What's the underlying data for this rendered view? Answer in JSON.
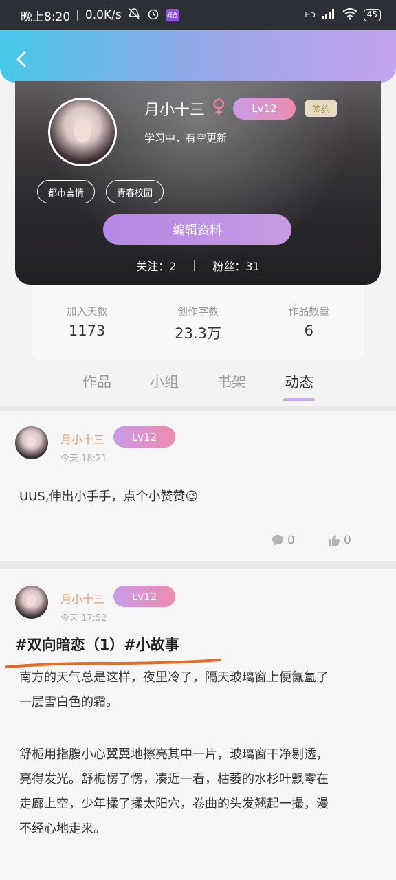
{
  "status_bar": {
    "time": "晚上8:20",
    "speed": "0.0K/s",
    "app_badge": "概览",
    "network": "HD",
    "battery": "45"
  },
  "profile": {
    "name": "月小十三",
    "gender_symbol": "♀",
    "level": "Lv12",
    "signed_label": "签约",
    "bio": "学习中，有空更新",
    "tags": [
      "都市言情",
      "青春校园"
    ],
    "edit_button": "编辑资料",
    "following": "关注：2",
    "followers": "粉丝：31"
  },
  "stats": [
    {
      "label": "加入天数",
      "value": "1173"
    },
    {
      "label": "创作字数",
      "value": "23.3万"
    },
    {
      "label": "作品数量",
      "value": "6"
    }
  ],
  "tabs": [
    {
      "label": "作品",
      "active": false
    },
    {
      "label": "小组",
      "active": false
    },
    {
      "label": "书架",
      "active": false
    },
    {
      "label": "动态",
      "active": true
    }
  ],
  "posts": [
    {
      "author": "月小十三",
      "level": "Lv12",
      "time": "今天 18:21",
      "text": "UUS,伸出小手手，点个小赞赞😉",
      "comments": "0",
      "likes": "0"
    },
    {
      "author": "月小十三",
      "level": "Lv12",
      "time": "今天 17:52",
      "title": "#双向暗恋（1）#小故事",
      "paragraphs": [
        "南方的天气总是这样，夜里冷了，隔天玻璃窗上便氤氲了",
        "一层雪白色的霜。",
        "舒栀用指腹小心翼翼地擦亮其中一片，玻璃窗干净剔透，",
        "亮得发光。舒栀愣了愣，凑近一看，枯萎的水杉叶飘零在",
        "走廊上空，少年揉了揉太阳穴，卷曲的头发翘起一撮，漫",
        "不经心地走来。"
      ]
    }
  ],
  "colors": {
    "accent_purple": "#c9a9ee",
    "name_orange": "#e8a071",
    "underline_orange": "#e56a25"
  }
}
